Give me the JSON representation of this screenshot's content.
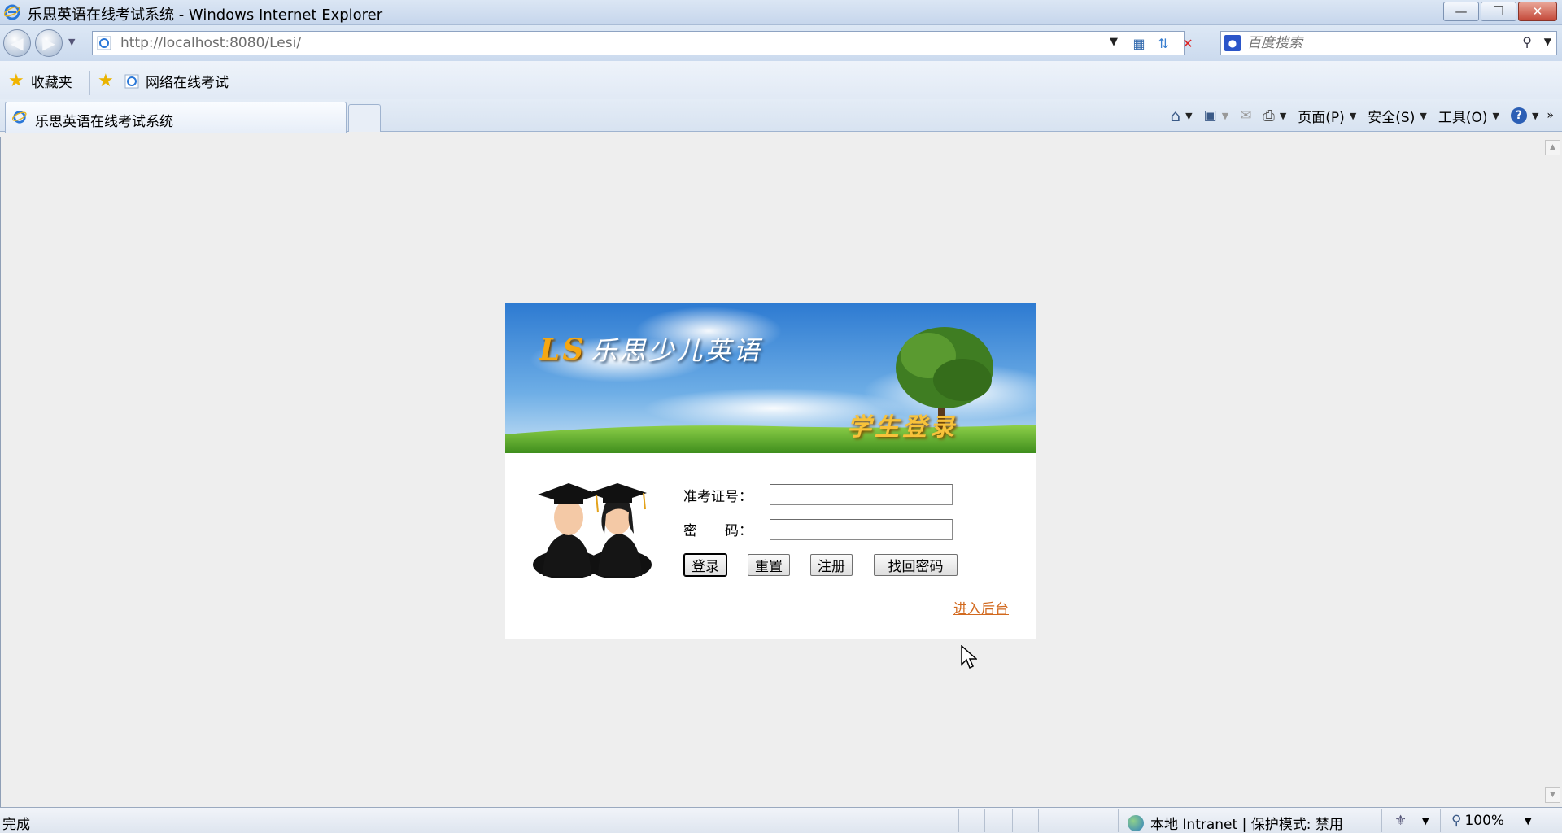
{
  "window": {
    "title": "乐思英语在线考试系统 - Windows Internet Explorer",
    "minimize_glyph": "—",
    "restore_glyph": "❐",
    "close_glyph": "✕"
  },
  "address_bar": {
    "url": "http://localhost:8080/Lesi/",
    "search_placeholder": "百度搜索"
  },
  "favorites_bar": {
    "favorites_label": "收藏夹",
    "link_label": "网络在线考试"
  },
  "tabs": [
    {
      "title": "乐思英语在线考试系统"
    }
  ],
  "command_bar": {
    "page_menu": "页面(P)",
    "safety_menu": "安全(S)",
    "tools_menu": "工具(O)"
  },
  "login_panel": {
    "brand_logo": "LS",
    "brand_name": "乐思少儿英语",
    "banner_title": "学生登录",
    "id_label": "准考证号：",
    "password_label": "密　　码：",
    "id_value": "",
    "password_value": "",
    "buttons": {
      "login": "登录",
      "reset": "重置",
      "register": "注册",
      "recover": "找回密码"
    },
    "admin_link": "进入后台"
  },
  "status_bar": {
    "status": "完成",
    "zone": "本地 Intranet | 保护模式: 禁用",
    "zoom": "100%"
  },
  "colors": {
    "link": "#d2691e",
    "banner_title": "#f8c23a",
    "brand_logo": "#f5a712",
    "page_background": "#eeeeee"
  },
  "icons": {
    "browser": "ie-icon",
    "back": "back-arrow-icon",
    "forward": "forward-arrow-icon",
    "favorites": "star-icon",
    "home": "home-icon",
    "feeds": "rss-icon",
    "mail": "mail-icon",
    "print": "printer-icon",
    "help": "help-icon",
    "cursor": "mouse-cursor-icon"
  }
}
